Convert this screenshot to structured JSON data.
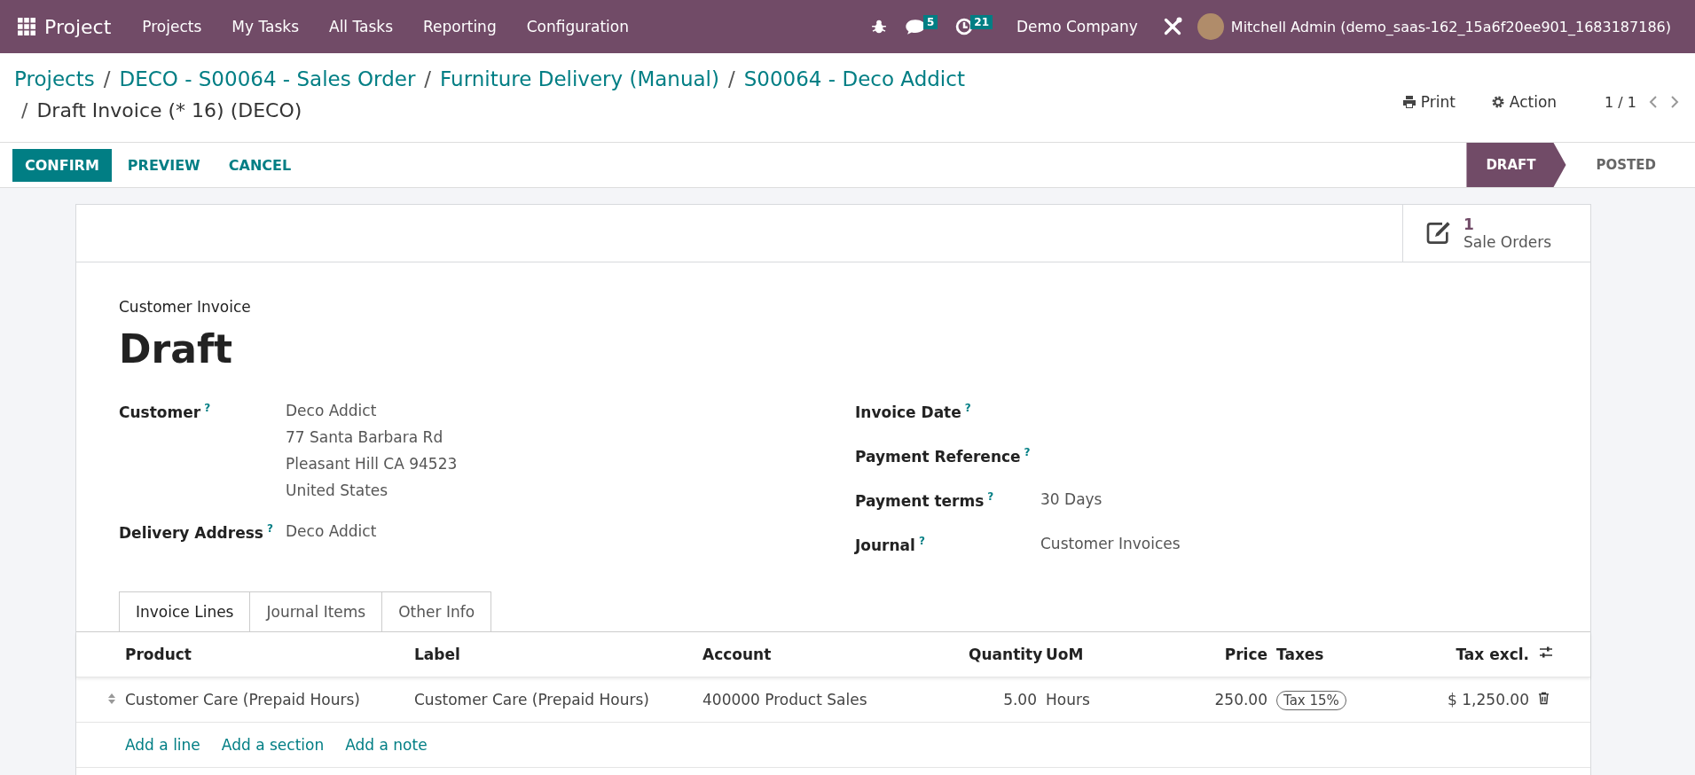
{
  "navbar": {
    "app_name": "Project",
    "menu": [
      "Projects",
      "My Tasks",
      "All Tasks",
      "Reporting",
      "Configuration"
    ],
    "messages_count": "5",
    "activities_count": "21",
    "company": "Demo Company",
    "user": "Mitchell Admin (demo_saas-162_15a6f20ee901_1683187186)"
  },
  "breadcrumbs": [
    {
      "label": "Projects"
    },
    {
      "label": "DECO - S00064 - Sales Order"
    },
    {
      "label": "Furniture Delivery (Manual)"
    },
    {
      "label": "S00064 - Deco Addict"
    }
  ],
  "current_record": "Draft Invoice (* 16) (DECO)",
  "separator": "/",
  "print_label": "Print",
  "action_label": "Action",
  "pager": "1 / 1",
  "buttons": [
    {
      "label": "CONFIRM",
      "primary": true
    },
    {
      "label": "PREVIEW",
      "primary": false
    },
    {
      "label": "CANCEL",
      "primary": false
    }
  ],
  "status_steps": [
    {
      "label": "DRAFT",
      "selected": true
    },
    {
      "label": "POSTED",
      "selected": false
    }
  ],
  "stat_button": {
    "count": "1",
    "label": "Sale Orders"
  },
  "form": {
    "subtitle": "Customer Invoice",
    "title": "Draft",
    "left_fields": [
      {
        "label": "Customer",
        "help": "?",
        "lines": [
          "Deco Addict",
          "77 Santa Barbara Rd",
          "Pleasant Hill CA 94523",
          "United States"
        ]
      },
      {
        "label": "Delivery Address",
        "help": "?",
        "lines": [
          "Deco Addict"
        ]
      }
    ],
    "right_fields": [
      {
        "label": "Invoice Date",
        "help": "?"
      },
      {
        "label": "Payment Reference",
        "help": "?"
      },
      {
        "label": "Payment terms",
        "help": "?",
        "lines": [
          "30 Days"
        ]
      },
      {
        "label": "Journal",
        "help": "?",
        "lines": [
          "Customer Invoices"
        ]
      }
    ]
  },
  "tabs": [
    {
      "label": "Invoice Lines",
      "selected": true
    },
    {
      "label": "Journal Items",
      "selected": false
    },
    {
      "label": "Other Info",
      "selected": false
    }
  ],
  "table": {
    "columns": [
      "Product",
      "Label",
      "Account",
      "Quantity",
      "UoM",
      "Price",
      "Taxes",
      "Tax excl."
    ],
    "rows": [
      {
        "product": "Customer Care (Prepaid Hours)",
        "label": "Customer Care (Prepaid Hours)",
        "account": "400000 Product Sales",
        "quantity": "5.00",
        "uom": "Hours",
        "price": "250.00",
        "taxes": [
          "Tax 15%"
        ],
        "subtotal": "$ 1,250.00"
      }
    ]
  },
  "add_links": [
    "Add a line",
    "Add a section",
    "Add a note"
  ]
}
